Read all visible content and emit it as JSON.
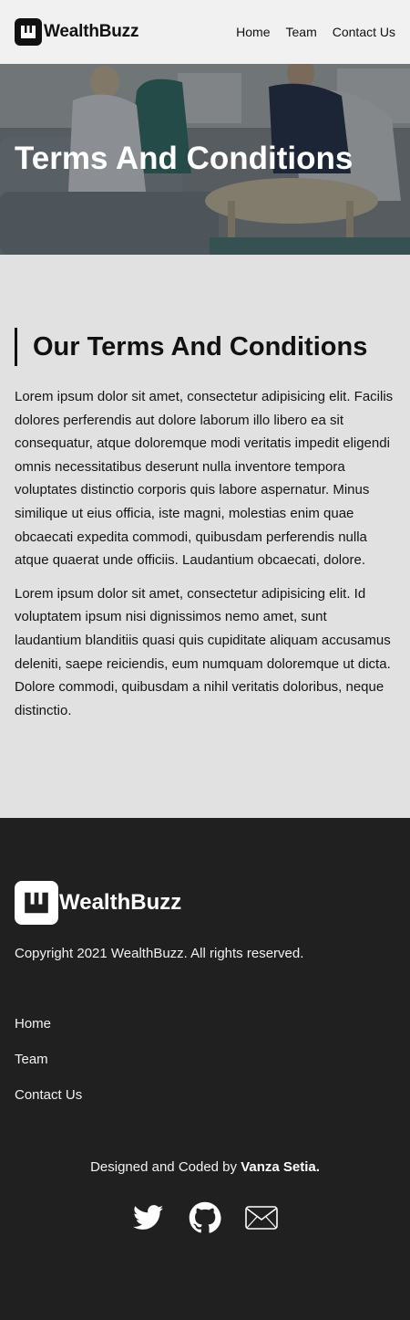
{
  "header": {
    "brand": "WealthBuzz",
    "nav": [
      {
        "label": "Home"
      },
      {
        "label": "Team"
      },
      {
        "label": "Contact Us"
      }
    ]
  },
  "hero": {
    "title": "Terms And Conditions"
  },
  "main": {
    "heading": "Our Terms And Conditions",
    "paragraphs": [
      "Lorem ipsum dolor sit amet, consectetur adipisicing elit. Facilis dolores perferendis aut dolore laborum illo libero ea sit consequatur, atque doloremque modi veritatis impedit eligendi omnis necessitatibus deserunt nulla inventore tempora voluptates distinctio corporis quis labore aspernatur. Minus similique ut eius officia, iste magni, molestias enim quae obcaecati expedita commodi, quibusdam perferendis nulla atque quaerat unde officiis. Laudantium obcaecati, dolore.",
      "Lorem ipsum dolor sit amet, consectetur adipisicing elit. Id voluptatem ipsum nisi dignissimos nemo amet, sunt laudantium blanditiis quasi quis cupiditate aliquam accusamus deleniti, saepe reiciendis, eum numquam doloremque ut dicta. Dolore commodi, quibusdam a nihil veritatis doloribus, neque distinctio."
    ]
  },
  "footer": {
    "brand": "WealthBuzz",
    "copyright": "Copyright 2021 WealthBuzz. All rights reserved.",
    "links": [
      {
        "label": "Home"
      },
      {
        "label": "Team"
      },
      {
        "label": "Contact Us"
      }
    ],
    "credit_prefix": "Designed and Coded by ",
    "credit_name": "Vanza Setia.",
    "socials": [
      {
        "icon": "twitter-icon"
      },
      {
        "icon": "github-icon"
      },
      {
        "icon": "mail-icon"
      }
    ]
  },
  "colors": {
    "header_bg": "#f1f1f1",
    "main_bg": "#e1e1e1",
    "footer_bg": "#202020",
    "text": "#111111"
  }
}
